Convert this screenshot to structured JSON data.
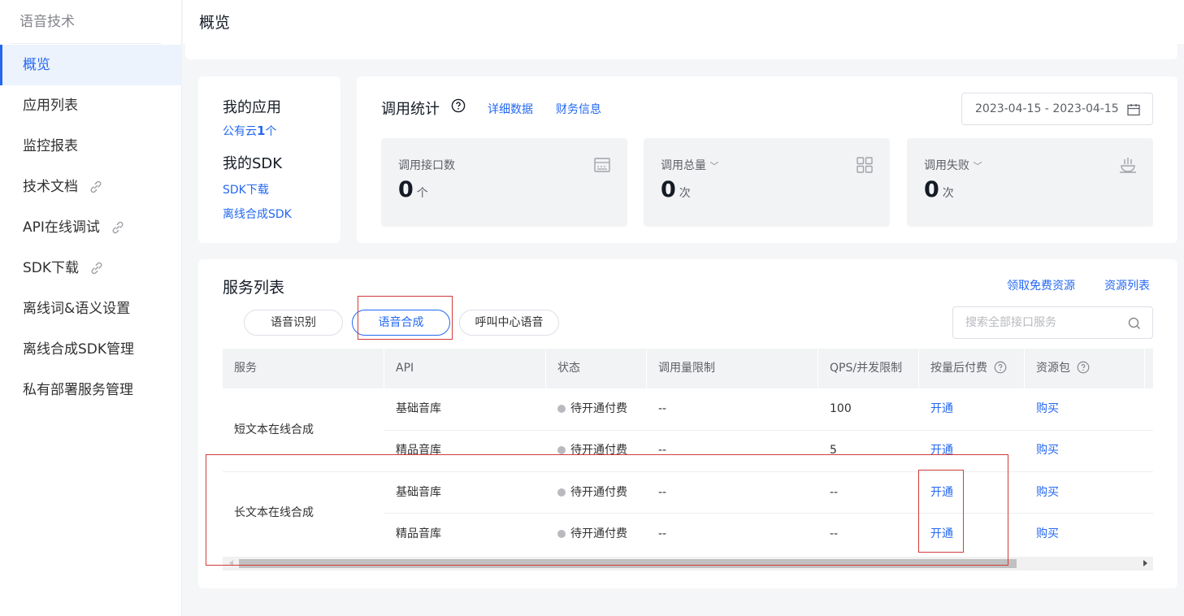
{
  "sidebar": {
    "title": "语音技术",
    "items": [
      {
        "label": "概览",
        "active": true
      },
      {
        "label": "应用列表"
      },
      {
        "label": "监控报表"
      },
      {
        "label": "技术文档",
        "icon": "link-icon"
      },
      {
        "label": "API在线调试",
        "icon": "link-icon"
      },
      {
        "label": "SDK下载",
        "icon": "link-icon"
      },
      {
        "label": "离线词&语义设置"
      },
      {
        "label": "离线合成SDK管理"
      },
      {
        "label": "私有部署服务管理"
      }
    ]
  },
  "header": {
    "title": "概览"
  },
  "my_app": {
    "heading": "我的应用",
    "public_cloud_prefix": "公有云",
    "public_cloud_count": "1",
    "public_cloud_suffix": "个",
    "sdk_heading": "我的SDK",
    "sdk_download": "SDK下载",
    "offline_sdk": "离线合成SDK"
  },
  "stats": {
    "title": "调用统计",
    "detail_link": "详细数据",
    "finance_link": "财务信息",
    "date_range": "2023-04-15 - 2023-04-15",
    "boxes": [
      {
        "label": "调用接口数",
        "value": "0",
        "unit": "个",
        "icon": "api-icon"
      },
      {
        "label": "调用总量",
        "value": "0",
        "unit": "次",
        "icon": "grid-icon"
      },
      {
        "label": "调用失败",
        "value": "0",
        "unit": "次",
        "icon": "failure-icon"
      }
    ]
  },
  "services": {
    "title": "服务列表",
    "free_link": "领取免费资源",
    "resource_link": "资源列表",
    "tabs": [
      "语音识别",
      "语音合成",
      "呼叫中心语音"
    ],
    "active_tab": "语音合成",
    "search_placeholder": "搜索全部接口服务",
    "columns": [
      "服务",
      "API",
      "状态",
      "调用量限制",
      "QPS/并发限制",
      "按量后付费",
      "资源包"
    ],
    "groups": [
      {
        "service": "短文本在线合成",
        "rows": [
          {
            "api": "基础音库",
            "status": "待开通付费",
            "limit": "--",
            "qps": "100",
            "postpaid": "开通",
            "package": "购买"
          },
          {
            "api": "精品音库",
            "status": "待开通付费",
            "limit": "--",
            "qps": "5",
            "postpaid": "开通",
            "package": "购买"
          }
        ]
      },
      {
        "service": "长文本在线合成",
        "rows": [
          {
            "api": "基础音库",
            "status": "待开通付费",
            "limit": "--",
            "qps": "--",
            "postpaid": "开通",
            "package": "购买"
          },
          {
            "api": "精品音库",
            "status": "待开通付费",
            "limit": "--",
            "qps": "--",
            "postpaid": "开通",
            "package": "购买"
          }
        ]
      }
    ]
  },
  "colors": {
    "accent": "#2468f2",
    "annotation": "#d33b3b"
  }
}
